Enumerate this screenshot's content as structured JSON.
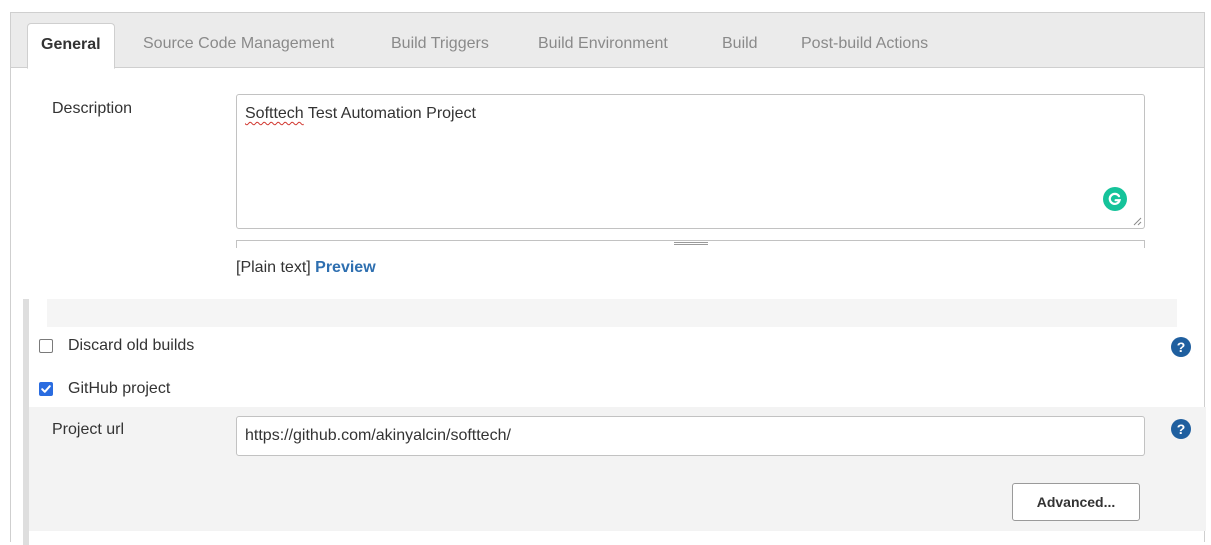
{
  "tabs": [
    {
      "label": "General",
      "active": true
    },
    {
      "label": "Source Code Management",
      "active": false
    },
    {
      "label": "Build Triggers",
      "active": false
    },
    {
      "label": "Build Environment",
      "active": false
    },
    {
      "label": "Build",
      "active": false
    },
    {
      "label": "Post-build Actions",
      "active": false
    }
  ],
  "description": {
    "label": "Description",
    "value_prefix": "Softtech",
    "value_rest": " Test Automation Project",
    "format_label": "[Plain text]",
    "preview_link": "Preview"
  },
  "options": {
    "discard_old_builds": {
      "label": "Discard old builds",
      "checked": false
    },
    "github_project": {
      "label": "GitHub project",
      "checked": true
    }
  },
  "project_url": {
    "label": "Project url",
    "value": "https://github.com/akinyalcin/softtech/"
  },
  "advanced_button": "Advanced...",
  "help_glyph": "?",
  "colors": {
    "accent": "#2a6ce0",
    "link": "#2e6fb0",
    "help": "#1f5f9f",
    "grammarly": "#15c39a"
  }
}
